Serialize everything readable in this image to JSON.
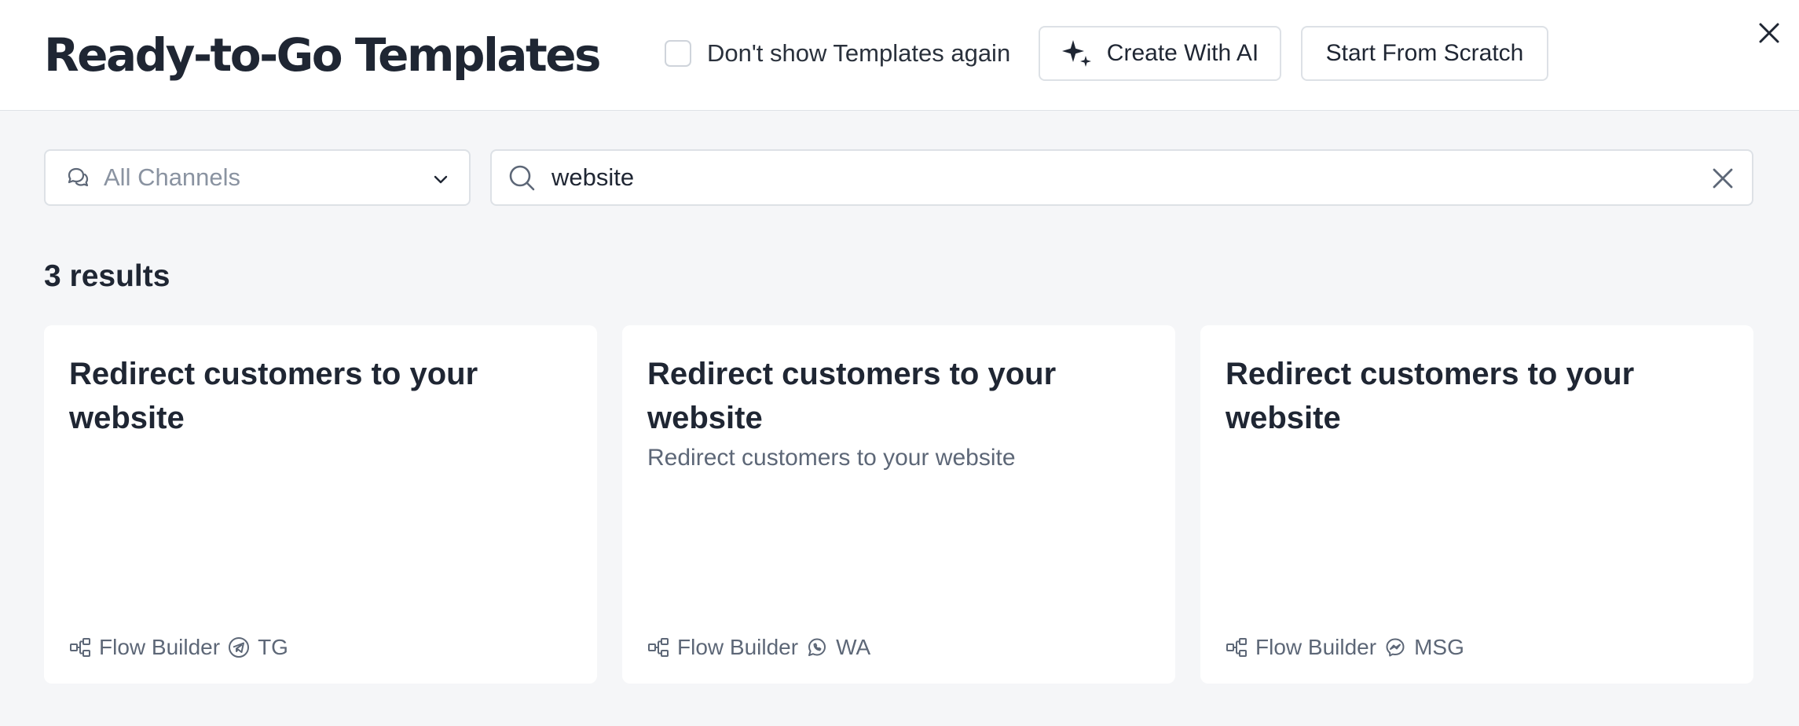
{
  "header": {
    "title": "Ready-to-Go Templates",
    "dont_show_label": "Don't show Templates again",
    "dont_show_checked": false,
    "create_ai_label": "Create With AI",
    "start_scratch_label": "Start From Scratch"
  },
  "filters": {
    "channel_selected": "All Channels",
    "search_value": "website"
  },
  "results": {
    "count_label": "3 results",
    "cards": [
      {
        "title": "Redirect customers to your website",
        "description": "",
        "type": "Flow Builder",
        "channel": "TG",
        "channel_icon": "telegram-icon"
      },
      {
        "title": "Redirect customers to your website",
        "description": "Redirect customers to your website",
        "type": "Flow Builder",
        "channel": "WA",
        "channel_icon": "whatsapp-icon"
      },
      {
        "title": "Redirect customers to your website",
        "description": "",
        "type": "Flow Builder",
        "channel": "MSG",
        "channel_icon": "messenger-icon"
      }
    ]
  },
  "colors": {
    "text_primary": "#1f2633",
    "text_secondary": "#5d6777",
    "placeholder": "#8a93a1",
    "border": "#dde1e6",
    "page_background": "#f5f6f8",
    "surface": "#ffffff"
  }
}
